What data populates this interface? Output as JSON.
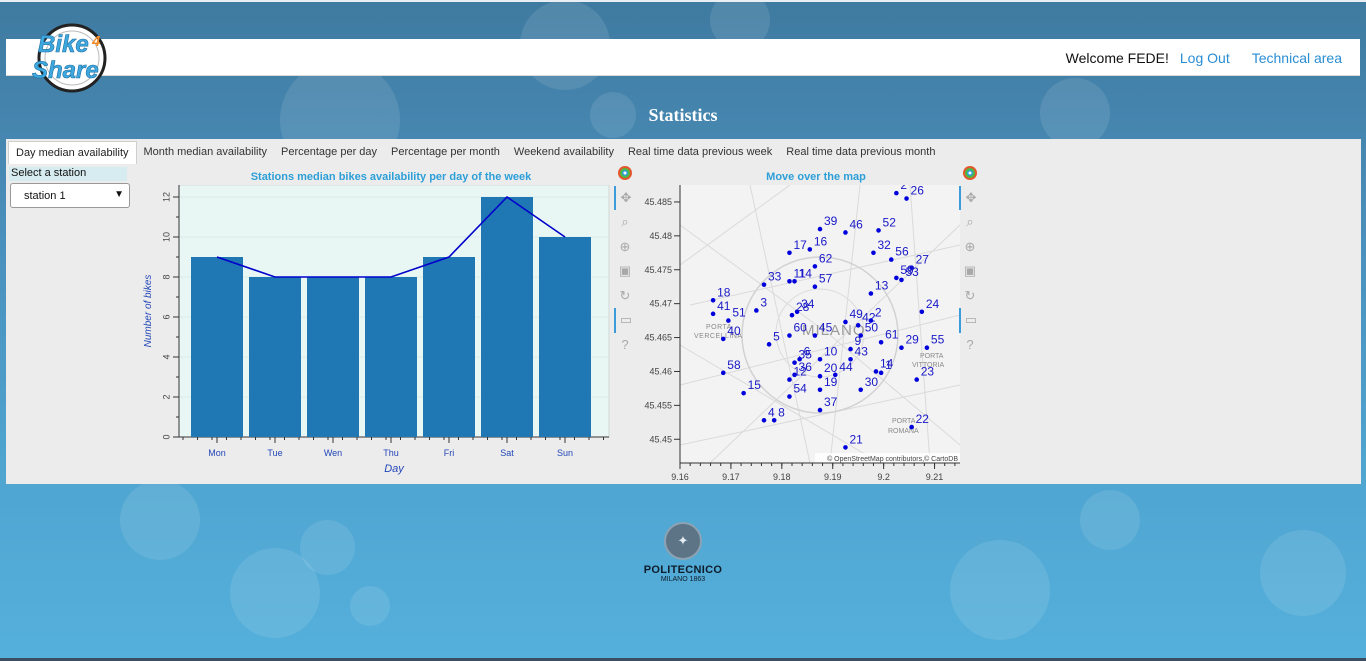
{
  "navbar": {
    "logo_line1": "Bike",
    "logo_num": "4",
    "logo_line2": "Share",
    "welcome": "Welcome FEDE!",
    "logout": "Log Out",
    "technical": "Technical area"
  },
  "page_title": "Statistics",
  "tabs": [
    {
      "label": "Day median availability",
      "active": true
    },
    {
      "label": "Month median availability"
    },
    {
      "label": "Percentage per day"
    },
    {
      "label": "Percentage per month"
    },
    {
      "label": "Weekend availability"
    },
    {
      "label": "Real time data previous week"
    },
    {
      "label": "Real time data previous month"
    }
  ],
  "station_select": {
    "label": "Select a station",
    "value": "station 1"
  },
  "toolbar_icons": [
    "pan-icon",
    "box-zoom-icon",
    "wheel-zoom-icon",
    "save-icon",
    "reset-icon",
    "hover-icon",
    "help-icon"
  ],
  "chart_data": [
    {
      "type": "bar",
      "title": "Stations median bikes availability per day of the week",
      "xlabel": "Day",
      "ylabel": "Number of bikes",
      "categories": [
        "Mon",
        "Tue",
        "Wen",
        "Thu",
        "Fri",
        "Sat",
        "Sun"
      ],
      "values": [
        9,
        8,
        8,
        8,
        9,
        12,
        10
      ],
      "line_values": [
        9,
        8,
        8,
        8,
        9,
        12,
        10
      ],
      "yticks": [
        "0",
        "2",
        "4",
        "6",
        "8",
        "10",
        "12"
      ],
      "ylim": [
        0,
        12.6
      ],
      "bar_color": "#1f77b4",
      "line_color": "#0000cc",
      "background": "#e8f7f4"
    },
    {
      "type": "scatter",
      "title": "Move over the map",
      "x_ticks": [
        "9.16",
        "9.17",
        "9.18",
        "9.19",
        "9.2",
        "9.21"
      ],
      "y_ticks": [
        "45.485",
        "45.48",
        "45.475",
        "45.47",
        "45.465",
        "45.46",
        "45.455",
        "45.45"
      ],
      "xlim": [
        9.16,
        9.215
      ],
      "ylim": [
        45.4465,
        45.4875
      ],
      "point_color": "#0000dd",
      "map_labels": [
        "PORTA VERCELLINA",
        "MILANO",
        "PORTA VITTORIA",
        "PORTA ROMANA"
      ],
      "attribution": "© OpenStreetMap contributors,© CartoDB",
      "points": [
        {
          "id": "26",
          "x": 9.2045,
          "y": 45.4855
        },
        {
          "id": "2",
          "x": 9.2025,
          "y": 45.4863
        },
        {
          "id": "39",
          "x": 9.1875,
          "y": 45.481
        },
        {
          "id": "46",
          "x": 9.1925,
          "y": 45.4805
        },
        {
          "id": "52",
          "x": 9.199,
          "y": 45.4808
        },
        {
          "id": "17",
          "x": 9.1815,
          "y": 45.4775
        },
        {
          "id": "16",
          "x": 9.1855,
          "y": 45.478
        },
        {
          "id": "32",
          "x": 9.198,
          "y": 45.4775
        },
        {
          "id": "56",
          "x": 9.2015,
          "y": 45.4765
        },
        {
          "id": "62",
          "x": 9.1865,
          "y": 45.4755
        },
        {
          "id": "27",
          "x": 9.2055,
          "y": 45.4753
        },
        {
          "id": "11",
          "x": 9.1815,
          "y": 45.4733
        },
        {
          "id": "14",
          "x": 9.1825,
          "y": 45.4733
        },
        {
          "id": "33",
          "x": 9.1765,
          "y": 45.4728
        },
        {
          "id": "57",
          "x": 9.1865,
          "y": 45.4725
        },
        {
          "id": "53",
          "x": 9.2035,
          "y": 45.4735
        },
        {
          "id": "59",
          "x": 9.2025,
          "y": 45.4738
        },
        {
          "id": "13",
          "x": 9.1975,
          "y": 45.4715
        },
        {
          "id": "18",
          "x": 9.1665,
          "y": 45.4705
        },
        {
          "id": "41",
          "x": 9.1665,
          "y": 45.4685
        },
        {
          "id": "3",
          "x": 9.175,
          "y": 45.469
        },
        {
          "id": "34",
          "x": 9.183,
          "y": 45.4688
        },
        {
          "id": "28",
          "x": 9.182,
          "y": 45.4683
        },
        {
          "id": "24",
          "x": 9.2075,
          "y": 45.4688
        },
        {
          "id": "51",
          "x": 9.1695,
          "y": 45.4675
        },
        {
          "id": "49",
          "x": 9.1925,
          "y": 45.4673
        },
        {
          "id": "42",
          "x": 9.195,
          "y": 45.4668
        },
        {
          "id": "2",
          "x": 9.1975,
          "y": 45.4675
        },
        {
          "id": "60",
          "x": 9.1815,
          "y": 45.4653
        },
        {
          "id": "45",
          "x": 9.1865,
          "y": 45.4653
        },
        {
          "id": "50",
          "x": 9.1955,
          "y": 45.4653
        },
        {
          "id": "40",
          "x": 9.1685,
          "y": 45.4648
        },
        {
          "id": "5",
          "x": 9.1775,
          "y": 45.464
        },
        {
          "id": "61",
          "x": 9.1995,
          "y": 45.4643
        },
        {
          "id": "29",
          "x": 9.2035,
          "y": 45.4635
        },
        {
          "id": "55",
          "x": 9.2085,
          "y": 45.4635
        },
        {
          "id": "9",
          "x": 9.1935,
          "y": 45.4633
        },
        {
          "id": "10",
          "x": 9.1875,
          "y": 45.4618
        },
        {
          "id": "43",
          "x": 9.1935,
          "y": 45.4618
        },
        {
          "id": "35",
          "x": 9.1825,
          "y": 45.4613
        },
        {
          "id": "6",
          "x": 9.1835,
          "y": 45.4618
        },
        {
          "id": "1",
          "x": 9.1995,
          "y": 45.4598
        },
        {
          "id": "14",
          "x": 9.1985,
          "y": 45.46
        },
        {
          "id": "36",
          "x": 9.1825,
          "y": 45.4595
        },
        {
          "id": "12",
          "x": 9.1815,
          "y": 45.4588
        },
        {
          "id": "20",
          "x": 9.1875,
          "y": 45.4593
        },
        {
          "id": "44",
          "x": 9.1905,
          "y": 45.4595
        },
        {
          "id": "58",
          "x": 9.1685,
          "y": 45.4598
        },
        {
          "id": "23",
          "x": 9.2065,
          "y": 45.4588
        },
        {
          "id": "19",
          "x": 9.1875,
          "y": 45.4573
        },
        {
          "id": "30",
          "x": 9.1955,
          "y": 45.4573
        },
        {
          "id": "15",
          "x": 9.1725,
          "y": 45.4568
        },
        {
          "id": "54",
          "x": 9.1815,
          "y": 45.4563
        },
        {
          "id": "37",
          "x": 9.1875,
          "y": 45.4543
        },
        {
          "id": "4",
          "x": 9.1765,
          "y": 45.4528
        },
        {
          "id": "8",
          "x": 9.1785,
          "y": 45.4528
        },
        {
          "id": "22",
          "x": 9.2055,
          "y": 45.4518
        },
        {
          "id": "21",
          "x": 9.1925,
          "y": 45.4488
        }
      ]
    }
  ],
  "footer": {
    "name": "POLITECNICO",
    "sub": "MILANO 1863"
  }
}
